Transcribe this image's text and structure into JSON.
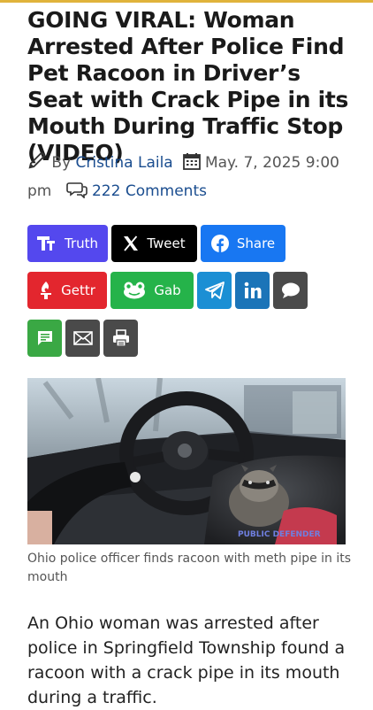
{
  "article": {
    "headline": "GOING VIRAL: Woman Arrested After Police Find Pet Racoon in Driver’s Seat with Crack Pipe in its Mouth During Traffic Stop (VIDEO)",
    "byline_prefix": "By",
    "author": "Cristina Laila",
    "date": "May. 7, 2025 9:00 pm",
    "comments": "222 Comments",
    "image_caption": "Ohio police officer finds racoon with meth pipe in its mouth",
    "image_watermark": "PUBLIC DEFENDER",
    "body": "An Ohio woman was arrested after police in Springfield Township found a racoon with a crack pipe in its mouth during a traffic."
  },
  "share": {
    "truth": {
      "label": "Truth",
      "color": "#5448ee"
    },
    "tweet": {
      "label": "Tweet",
      "color": "#000000"
    },
    "facebook": {
      "label": "Share",
      "color": "#1877f2"
    },
    "gettr": {
      "label": "Gettr",
      "color": "#e3262e"
    },
    "gab": {
      "label": "Gab",
      "color": "#25b34a"
    },
    "telegram": {
      "icon": "telegram-icon",
      "color": "#1b8fd4"
    },
    "linkedin": {
      "icon": "linkedin-icon",
      "color": "#1b74b8"
    },
    "comment": {
      "icon": "comment-icon",
      "color": "#4a4a4a"
    },
    "sms": {
      "icon": "sms-icon",
      "color": "#3aa844"
    },
    "email": {
      "icon": "email-icon",
      "color": "#4a4a4a"
    },
    "print": {
      "icon": "print-icon",
      "color": "#4a4a4a"
    }
  },
  "colors": {
    "link": "#1a4d8f",
    "accent_bar": "#e0b33b"
  }
}
